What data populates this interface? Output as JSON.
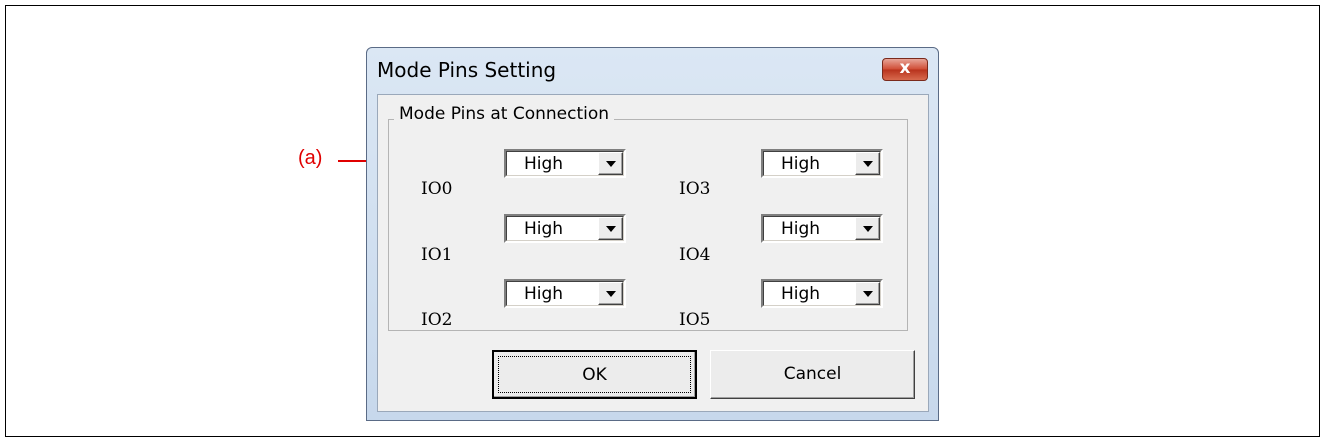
{
  "annotation": {
    "label": "(a)",
    "color": "#e00000"
  },
  "dialog": {
    "title": "Mode Pins Setting",
    "close_glyph": "x",
    "group_label": "Mode Pins at Connection",
    "pins": [
      {
        "label": "IO0",
        "value": "High"
      },
      {
        "label": "IO1",
        "value": "High"
      },
      {
        "label": "IO2",
        "value": "High"
      },
      {
        "label": "IO3",
        "value": "High"
      },
      {
        "label": "IO4",
        "value": "High"
      },
      {
        "label": "IO5",
        "value": "High"
      }
    ],
    "ok_label": "OK",
    "cancel_label": "Cancel"
  }
}
